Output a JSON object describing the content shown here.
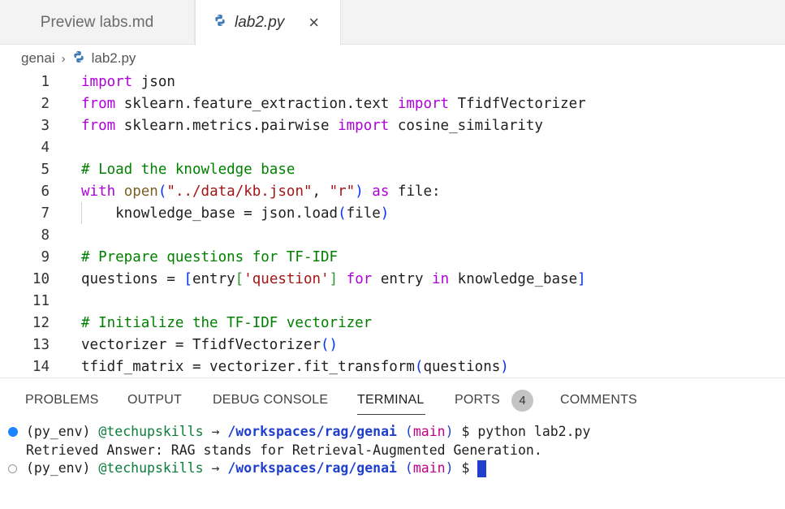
{
  "tabs": [
    {
      "label": "Preview labs.md",
      "active": false
    },
    {
      "label": "lab2.py",
      "active": true
    }
  ],
  "tab_close_glyph": "×",
  "breadcrumb": {
    "folder": "genai",
    "separator": "›",
    "file": "lab2.py"
  },
  "editor": {
    "line_numbers": [
      "1",
      "2",
      "3",
      "4",
      "5",
      "6",
      "7",
      "8",
      "9",
      "10",
      "11",
      "12",
      "13",
      "14"
    ],
    "lines": [
      [
        "import",
        " json"
      ],
      [
        "from",
        " sklearn.feature_extraction.text ",
        "import",
        " TfidfVectorizer"
      ],
      [
        "from",
        " sklearn.metrics.pairwise ",
        "import",
        " cosine_similarity"
      ],
      [],
      [
        "# Load the knowledge base"
      ],
      [
        "with",
        " ",
        "open",
        "(",
        "\"../data/kb.json\"",
        ", ",
        "\"r\"",
        ")",
        " as",
        " file:"
      ],
      [
        "    knowledge_base = json.load",
        "(",
        "file",
        ")"
      ],
      [],
      [
        "# Prepare questions for TF-IDF"
      ],
      [
        "questions = ",
        "[",
        "entry",
        "[",
        "'question'",
        "]",
        " for",
        " entry ",
        "in",
        " knowledge_base",
        "]"
      ],
      [],
      [
        "# Initialize the TF-IDF vectorizer"
      ],
      [
        "vectorizer = TfidfVectorizer",
        "()"
      ],
      [
        "tfidf_matrix = vectorizer.fit_transform",
        "(",
        "questions",
        ")"
      ]
    ]
  },
  "panel": {
    "tabs": [
      "PROBLEMS",
      "OUTPUT",
      "DEBUG CONSOLE",
      "TERMINAL",
      "PORTS",
      "COMMENTS"
    ],
    "active_tab": "TERMINAL",
    "ports_badge": "4"
  },
  "terminal": {
    "line1": {
      "env": "(py_env) ",
      "user": "@techupskills",
      "arrow": " → ",
      "path": "/workspaces/rag/genai",
      "branch_open": " (",
      "branch": "main",
      "branch_close": ")",
      "cmd": " $ python lab2.py"
    },
    "line2": "Retrieved Answer: RAG stands for Retrieval-Augmented Generation.",
    "line3": {
      "env": "(py_env) ",
      "user": "@techupskills",
      "arrow": " → ",
      "path": "/workspaces/rag/genai",
      "branch_open": " (",
      "branch": "main",
      "branch_close": ")",
      "cmd": " $ "
    }
  },
  "colors": {
    "keyword": "#af00db",
    "string": "#a31515",
    "comment": "#008000",
    "accent": "#1a85ff"
  }
}
